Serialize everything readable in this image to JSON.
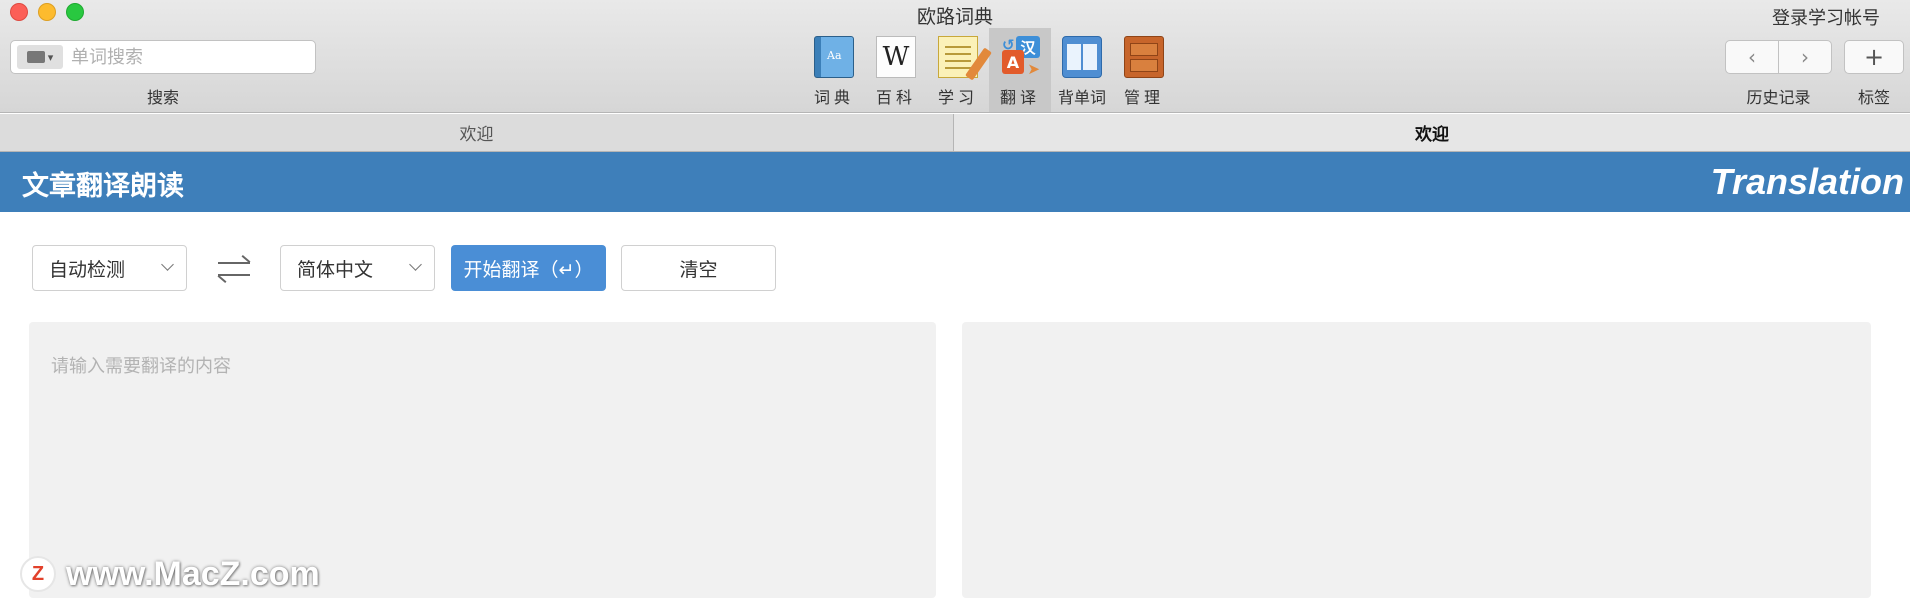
{
  "window": {
    "title": "欧路词典",
    "login_label": "登录学习帐号"
  },
  "search": {
    "placeholder": "单词搜索",
    "caption": "搜索",
    "scope_icon": "card-dropdown-icon"
  },
  "toolbar": {
    "tools": [
      {
        "label": "词典",
        "icon": "dictionary-book-icon",
        "active": false
      },
      {
        "label": "百科",
        "icon": "wikipedia-icon",
        "active": false
      },
      {
        "label": "学习",
        "icon": "notepad-pencil-icon",
        "active": false
      },
      {
        "label": "翻译",
        "icon": "translate-icon",
        "active": true
      },
      {
        "label": "背单词",
        "icon": "vocabulary-book-icon",
        "active": false
      },
      {
        "label": "管理",
        "icon": "cabinet-icon",
        "active": false
      }
    ],
    "icon_glyphs": {
      "wiki": "W",
      "trans_a": "A",
      "trans_z": "汉"
    },
    "history_caption": "历史记录",
    "tags_caption": "标签",
    "back_glyph": "‹",
    "forward_glyph": "›",
    "add_glyph": "+"
  },
  "tabs": [
    {
      "label": "欢迎",
      "active": false
    },
    {
      "label": "欢迎",
      "active": true
    }
  ],
  "banner": {
    "title": "文章翻译朗读",
    "english": "Translation",
    "color": "#3e7fba"
  },
  "controls": {
    "source_lang": "自动检测",
    "target_lang": "简体中文",
    "translate_button": "开始翻译（↵）",
    "clear_button": "清空",
    "accent_color": "#4a8ed6"
  },
  "input_panel": {
    "placeholder": "请输入需要翻译的内容",
    "value": ""
  },
  "output_panel": {
    "value": ""
  },
  "watermark": {
    "logo_letter": "Z",
    "text": "www.MacZ.com"
  }
}
